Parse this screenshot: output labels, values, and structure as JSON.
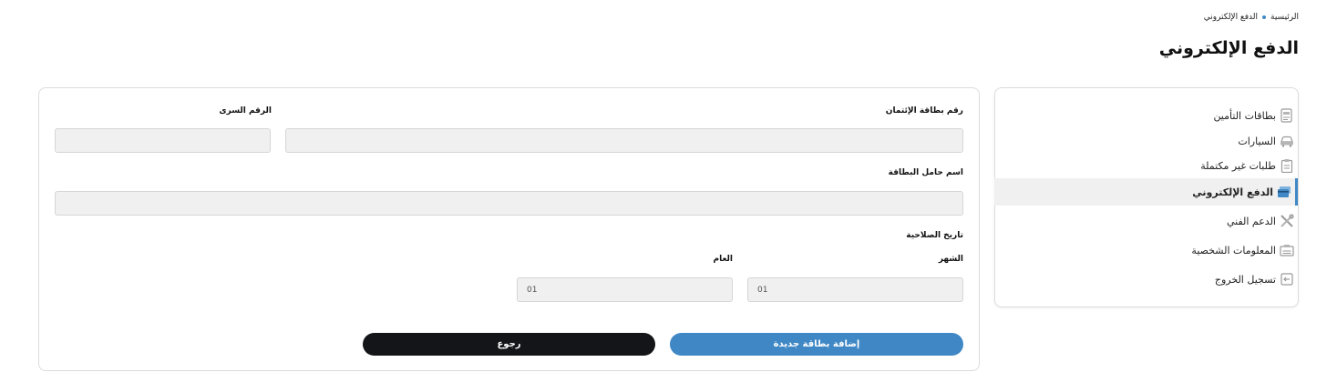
{
  "breadcrumb": {
    "home": "الرئيسية",
    "current": "الدفع الإلكتروني"
  },
  "page": {
    "title": "الدفع الإلكتروني"
  },
  "sidebar": {
    "items": [
      {
        "label": "بطاقات التأمين",
        "icon": "insurance-card-icon"
      },
      {
        "label": "السيارات",
        "icon": "car-icon"
      },
      {
        "label": "طلبات غير مكتملة",
        "icon": "clipboard-icon"
      },
      {
        "label": "الدفع الإلكتروني",
        "icon": "payment-card-icon",
        "active": true
      },
      {
        "label": "الدعم الفني",
        "icon": "tools-icon"
      },
      {
        "label": "المعلومات الشخصية",
        "icon": "id-card-icon"
      },
      {
        "label": "تسجيل الخروج",
        "icon": "logout-icon"
      }
    ]
  },
  "form": {
    "card_number_label": "رقم بطاقة الإئتمان",
    "card_number_value": "",
    "cvv_label": "الرقم السرى",
    "cvv_value": "",
    "holder_label": "اسم حامل البطاقة",
    "holder_value": "",
    "expiry_label": "تاريخ الصلاحية",
    "month_label": "الشهر",
    "month_value": "01",
    "year_label": "العام",
    "year_value": "01",
    "add_button": "إضافة بطاقة جديدة",
    "back_button": "رجوع"
  },
  "colors": {
    "accent": "#3f88c5",
    "dark_button": "#131518",
    "field_bg": "#f0f0f0"
  }
}
